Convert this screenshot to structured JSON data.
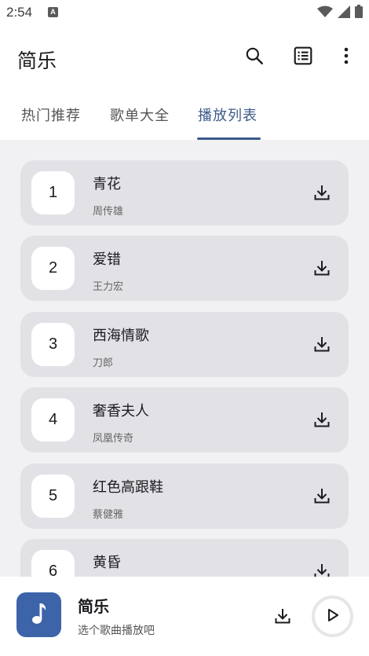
{
  "status_bar": {
    "time": "2:54",
    "notification_badge": "A"
  },
  "app_bar": {
    "title": "简乐",
    "icons": [
      "search-icon",
      "list-view-icon",
      "more-vertical-icon"
    ]
  },
  "tabs": [
    {
      "label": "热门推荐",
      "active": false
    },
    {
      "label": "歌单大全",
      "active": false
    },
    {
      "label": "播放列表",
      "active": true
    }
  ],
  "songs": [
    {
      "number": "1",
      "title": "青花",
      "artist": "周传雄"
    },
    {
      "number": "2",
      "title": "爱错",
      "artist": "王力宏"
    },
    {
      "number": "3",
      "title": "西海情歌",
      "artist": "刀郎"
    },
    {
      "number": "4",
      "title": "奢香夫人",
      "artist": "凤凰传奇"
    },
    {
      "number": "5",
      "title": "红色高跟鞋",
      "artist": "蔡健雅"
    },
    {
      "number": "6",
      "title": "黄昏",
      "artist": ""
    }
  ],
  "player": {
    "title": "简乐",
    "subtitle": "选个歌曲播放吧",
    "icons": [
      "music-note-icon",
      "download-icon",
      "play-icon"
    ]
  },
  "colors": {
    "accent": "#3c5a8a",
    "album_art": "#3d63a8",
    "card": "#e2e2e6",
    "list_bg": "#f1f1f3"
  }
}
